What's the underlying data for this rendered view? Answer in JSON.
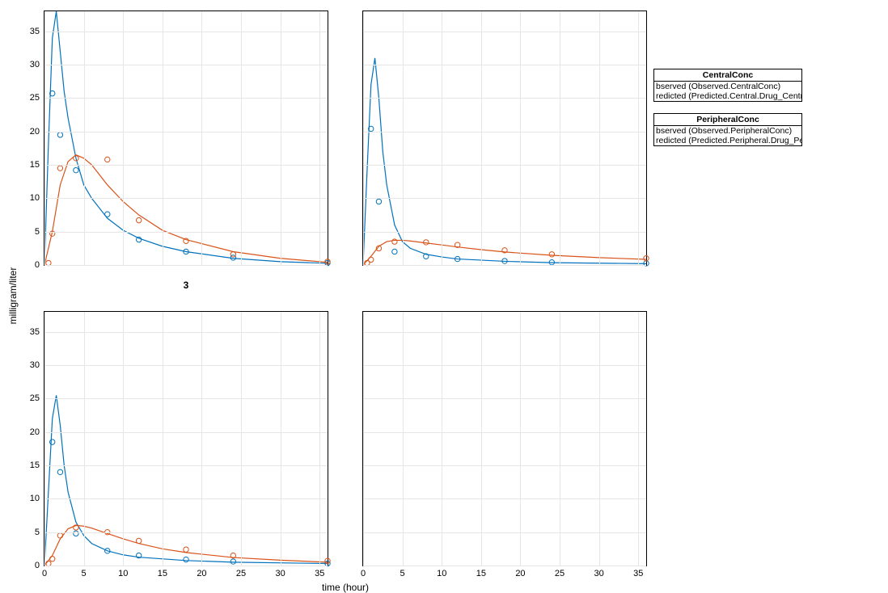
{
  "xlabel": "time (hour)",
  "ylabel": "milligram/liter",
  "colors": {
    "central": "#0072BD",
    "peripheral": "#D95319"
  },
  "legend": [
    {
      "title": "CentralConc",
      "items": [
        "bserved (Observed.CentralConc)",
        "redicted (Predicted.Central.Drug_Central)"
      ]
    },
    {
      "title": "PeripheralConc",
      "items": [
        "bserved (Observed.PeripheralConc)",
        "redicted (Predicted.Peripheral.Drug_Peripheral)"
      ]
    }
  ],
  "chart_data": [
    {
      "type": "line",
      "title": "3",
      "xlim": [
        0,
        36
      ],
      "ylim": [
        0,
        38
      ],
      "xticks": [
        0,
        5,
        10,
        15,
        20,
        25,
        30,
        35
      ],
      "yticks": [
        0,
        5,
        10,
        15,
        20,
        25,
        30,
        35
      ],
      "show_xticks": false,
      "series": [
        {
          "name": "Central observed",
          "role": "obs",
          "color": "central",
          "x": [
            1,
            2,
            4,
            8,
            12,
            18,
            24,
            36
          ],
          "y": [
            25.7,
            19.5,
            14.2,
            7.6,
            3.8,
            2.0,
            1.1,
            0.3
          ]
        },
        {
          "name": "Central predicted",
          "role": "pred",
          "color": "central",
          "x": [
            0,
            0.5,
            1,
            1.5,
            2,
            2.5,
            3,
            4,
            5,
            6,
            8,
            10,
            12,
            15,
            18,
            24,
            30,
            36
          ],
          "y": [
            0,
            18,
            34,
            38,
            32,
            26,
            22,
            16,
            12,
            10,
            7,
            5.2,
            4,
            2.8,
            2.0,
            1.0,
            0.5,
            0.25
          ]
        },
        {
          "name": "Peripheral observed",
          "role": "obs",
          "color": "peripheral",
          "x": [
            0.5,
            1,
            2,
            4,
            8,
            12,
            18,
            24,
            36
          ],
          "y": [
            0.3,
            4.7,
            14.5,
            16.0,
            15.8,
            6.7,
            3.6,
            1.6,
            0.5
          ]
        },
        {
          "name": "Peripheral predicted",
          "role": "pred",
          "color": "peripheral",
          "x": [
            0,
            1,
            2,
            3,
            4,
            5,
            6,
            8,
            10,
            12,
            15,
            18,
            24,
            30,
            36
          ],
          "y": [
            0,
            5,
            12,
            15.5,
            16.5,
            16,
            15,
            12,
            9.5,
            7.5,
            5.2,
            3.8,
            2.0,
            1.0,
            0.4
          ]
        }
      ]
    },
    {
      "type": "line",
      "xlim": [
        0,
        36
      ],
      "ylim": [
        0,
        38
      ],
      "xticks": [
        0,
        5,
        10,
        15,
        20,
        25,
        30,
        35
      ],
      "yticks": [
        0,
        5,
        10,
        15,
        20,
        25,
        30,
        35
      ],
      "show_xticks": false,
      "show_yticks": false,
      "series": [
        {
          "name": "Central observed",
          "role": "obs",
          "color": "central",
          "x": [
            1,
            2,
            4,
            8,
            12,
            18,
            24,
            36
          ],
          "y": [
            20.4,
            9.5,
            2.0,
            1.3,
            0.9,
            0.6,
            0.4,
            0.25
          ]
        },
        {
          "name": "Central predicted",
          "role": "pred",
          "color": "central",
          "x": [
            0,
            0.5,
            1,
            1.5,
            2,
            2.5,
            3,
            4,
            5,
            6,
            8,
            10,
            12,
            18,
            24,
            36
          ],
          "y": [
            0,
            14,
            27,
            31,
            25,
            17,
            12,
            6,
            3.5,
            2.5,
            1.6,
            1.2,
            0.9,
            0.55,
            0.35,
            0.2
          ]
        },
        {
          "name": "Peripheral observed",
          "role": "obs",
          "color": "peripheral",
          "x": [
            0.5,
            1,
            2,
            4,
            8,
            12,
            18,
            24,
            36
          ],
          "y": [
            0.3,
            0.8,
            2.5,
            3.5,
            3.4,
            3.0,
            2.2,
            1.6,
            1.0
          ]
        },
        {
          "name": "Peripheral predicted",
          "role": "pred",
          "color": "peripheral",
          "x": [
            0,
            1,
            2,
            3,
            4,
            5,
            6,
            8,
            10,
            12,
            15,
            18,
            24,
            30,
            36
          ],
          "y": [
            0,
            1.3,
            2.8,
            3.5,
            3.7,
            3.7,
            3.6,
            3.3,
            3.0,
            2.7,
            2.3,
            1.95,
            1.45,
            1.1,
            0.85
          ]
        }
      ]
    },
    {
      "type": "line",
      "xlim": [
        0,
        36
      ],
      "ylim": [
        0,
        38
      ],
      "xticks": [
        0,
        5,
        10,
        15,
        20,
        25,
        30,
        35
      ],
      "yticks": [
        0,
        5,
        10,
        15,
        20,
        25,
        30,
        35
      ],
      "show_xticks": true,
      "series": [
        {
          "name": "Central observed",
          "role": "obs",
          "color": "central",
          "x": [
            1,
            2,
            4,
            8,
            12,
            18,
            24,
            36
          ],
          "y": [
            18.5,
            14.0,
            4.8,
            2.2,
            1.5,
            0.9,
            0.6,
            0.3
          ]
        },
        {
          "name": "Central predicted",
          "role": "pred",
          "color": "central",
          "x": [
            0,
            0.5,
            1,
            1.5,
            2,
            2.5,
            3,
            4,
            5,
            6,
            8,
            10,
            12,
            18,
            24,
            36
          ],
          "y": [
            0,
            11,
            22,
            25.5,
            21,
            15,
            11,
            6.5,
            4.5,
            3.3,
            2.2,
            1.6,
            1.25,
            0.75,
            0.5,
            0.3
          ]
        },
        {
          "name": "Peripheral observed",
          "role": "obs",
          "color": "peripheral",
          "x": [
            0.5,
            1,
            2,
            4,
            8,
            12,
            18,
            24,
            36
          ],
          "y": [
            0.3,
            1.0,
            4.5,
            5.7,
            5.0,
            3.7,
            2.4,
            1.5,
            0.7
          ]
        },
        {
          "name": "Peripheral predicted",
          "role": "pred",
          "color": "peripheral",
          "x": [
            0,
            1,
            2,
            3,
            4,
            5,
            6,
            8,
            10,
            12,
            15,
            18,
            24,
            30,
            36
          ],
          "y": [
            0,
            1.5,
            4.0,
            5.5,
            6.0,
            5.9,
            5.6,
            4.8,
            4.0,
            3.3,
            2.5,
            1.95,
            1.2,
            0.8,
            0.5
          ]
        }
      ]
    },
    {
      "type": "line",
      "xlim": [
        0,
        36
      ],
      "ylim": [
        0,
        38
      ],
      "xticks": [
        0,
        5,
        10,
        15,
        20,
        25,
        30,
        35
      ],
      "yticks": [
        0,
        5,
        10,
        15,
        20,
        25,
        30,
        35
      ],
      "show_xticks": true,
      "show_yticks": false,
      "series": []
    }
  ]
}
